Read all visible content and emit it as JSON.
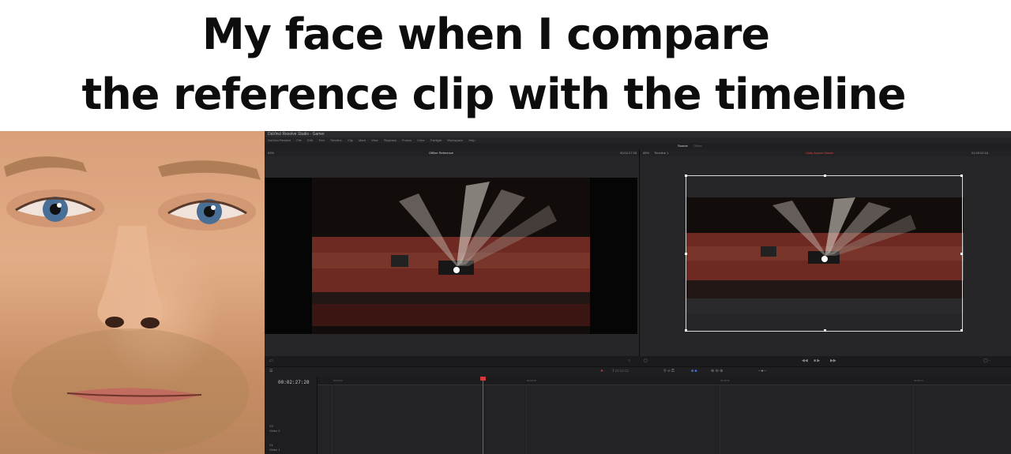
{
  "caption": {
    "line1": "My face when I compare",
    "line2": "the reference clip with the timeline"
  },
  "app": {
    "window_title": "DaVinci Resolve Studio - Gamer",
    "menu": [
      "DaVinci Resolve",
      "File",
      "Edit",
      "Trim",
      "Timeline",
      "Clip",
      "Mark",
      "View",
      "Playback",
      "Fusion",
      "Color",
      "Fairlight",
      "Workspace",
      "Help"
    ],
    "mode_active": "Source",
    "mode_inactive": "Offset",
    "left_viewer": {
      "zoom": "63%",
      "title": "Offline Reference",
      "timecode": "00:02:27:28"
    },
    "right_viewer": {
      "zoom": "65%",
      "timeline_name": "Timeline 1",
      "title": "Unity Aspect Master",
      "timecode": "01:00:02:16"
    },
    "timeline": {
      "timecode": "00:02:27:28",
      "tracks": [
        {
          "name": "V2",
          "label": "Video 2"
        },
        {
          "name": "V1",
          "label": "Video 1"
        }
      ],
      "ruler_marks": [
        "00:00:00",
        "00:02:48",
        "00:05:36",
        "00:08:24"
      ]
    },
    "icons": [
      "play-icon",
      "stop-icon",
      "skip-back-icon",
      "skip-forward-icon",
      "loop-icon",
      "blade-icon",
      "link-icon",
      "zoom-icon"
    ]
  }
}
